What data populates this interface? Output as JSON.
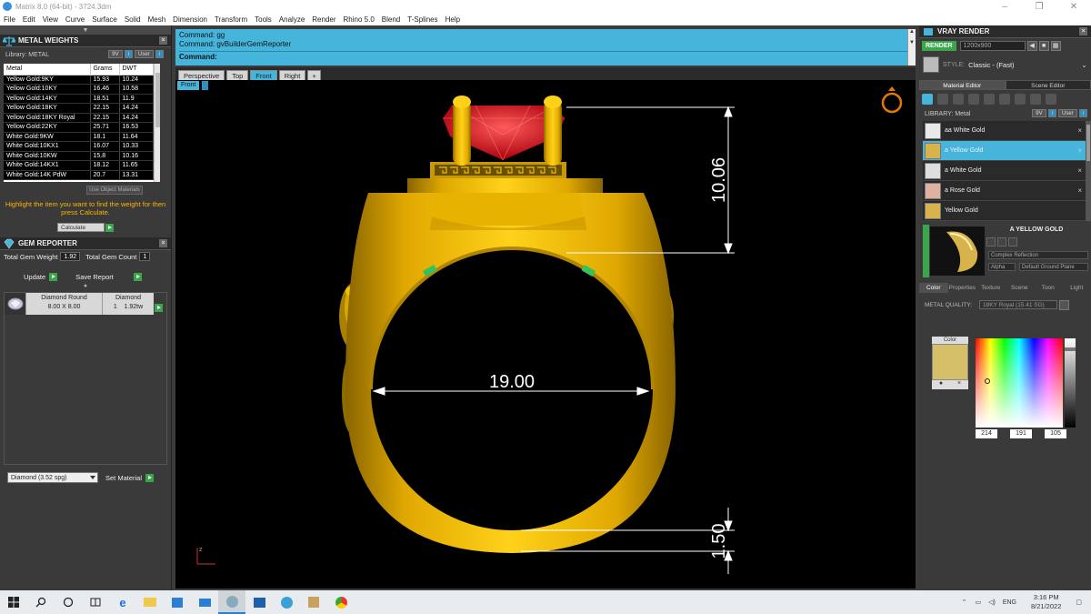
{
  "window": {
    "title": "Matrix 8.0 (64-bit) - 3724.3dm",
    "controls": [
      "–",
      "❐",
      "✕"
    ]
  },
  "menu": [
    "File",
    "Edit",
    "View",
    "Curve",
    "Surface",
    "Solid",
    "Mesh",
    "Dimension",
    "Transform",
    "Tools",
    "Analyze",
    "Render",
    "Rhino 5.0",
    "Blend",
    "T-Splines",
    "Help"
  ],
  "metal_weights": {
    "title": "METAL WEIGHTS",
    "library_label": "Library: METAL",
    "buttons": [
      "9V",
      "User"
    ],
    "columns": [
      "Metal",
      "Grams",
      "DWT"
    ],
    "rows": [
      [
        "Yellow Gold:9KY",
        "15.93",
        "10.24"
      ],
      [
        "Yellow Gold:10KY",
        "16.46",
        "10.58"
      ],
      [
        "Yellow Gold:14KY",
        "18.51",
        "11.9"
      ],
      [
        "Yellow Gold:18KY",
        "22.15",
        "14.24"
      ],
      [
        "Yellow Gold:18KY Royal",
        "22.15",
        "14.24"
      ],
      [
        "Yellow Gold:22KY",
        "25.71",
        "16.53"
      ],
      [
        "White Gold:9KW",
        "18.1",
        "11.64"
      ],
      [
        "White Gold:10KX1",
        "16.07",
        "10.33"
      ],
      [
        "White Gold:10KW",
        "15.8",
        "10.16"
      ],
      [
        "White Gold:14KX1",
        "18.12",
        "11.65"
      ],
      [
        "White Gold:14K PdW",
        "20.7",
        "13.31"
      ]
    ],
    "use_object_materials": "Use Object Materials",
    "hint": "Highlight the item you want to find the weight for then press Calculate.",
    "calculate_label": "Calculate"
  },
  "gem_reporter": {
    "title": "GEM REPORTER",
    "total_weight_label": "Total Gem Weight",
    "total_weight_value": "1.92",
    "total_count_label": "Total Gem Count",
    "total_count_value": "1",
    "update_label": "Update",
    "save_report_label": "Save Report",
    "gems": [
      {
        "shape": "Diamond Round",
        "size": "8.00 X 8.00",
        "material": "Diamond",
        "count": "1",
        "weight": "1.92tw"
      }
    ],
    "material_select": "Diamond   (3.52 spg)",
    "set_material_label": "Set Material"
  },
  "command": {
    "history": [
      "Command: gg",
      "Command: gvBuilderGemReporter"
    ],
    "prompt": "Command:"
  },
  "view_tabs": [
    "Perspective",
    "Top",
    "Front",
    "Right",
    "+"
  ],
  "active_view": "Front",
  "viewport": {
    "label": "Front",
    "dimensions": {
      "height": "10.06",
      "inner_diameter": "19.00",
      "shank": "1.50"
    },
    "axis_label": "z"
  },
  "vray": {
    "title": "VRAY RENDER",
    "render_label": "RENDER",
    "resolution": "1200x900",
    "style_label": "STYLE:",
    "style_value": "Classic - (Fast)",
    "tabs": [
      "Material Editor",
      "Scene Editor"
    ],
    "library_label": "LIBRARY: Metal",
    "library_buttons": [
      "9V",
      "User"
    ],
    "materials": [
      {
        "name": "aa White Gold",
        "color": "#e9e9e9"
      },
      {
        "name": "a Yellow Gold",
        "color": "#d8b24a"
      },
      {
        "name": "a White Gold",
        "color": "#dedede"
      },
      {
        "name": "a Rose Gold",
        "color": "#dcb3a0"
      },
      {
        "name": "Yellow Gold",
        "color": "#d8b24a"
      }
    ],
    "selected_material": "A YELLOW GOLD",
    "preview_fields": [
      "Complex Reflection",
      "Alpha",
      "Default Ground Plane"
    ],
    "color_tabs": [
      "Color",
      "Properties",
      "Texture",
      "Scene",
      "Toon",
      "Light"
    ],
    "metal_quality_label": "METAL QUALITY:",
    "metal_quality_value": "18KY Royal        (15.41 SG)",
    "color_label": "Color",
    "rgb": [
      "214",
      "191",
      "105"
    ]
  },
  "taskbar": {
    "time": "3:16 PM",
    "date": "8/21/2022",
    "lang": "ENG"
  },
  "colors": {
    "accent": "#45b5dc",
    "gold": "#f2b800",
    "gem": "#e0141e",
    "go": "#3aa64a"
  }
}
